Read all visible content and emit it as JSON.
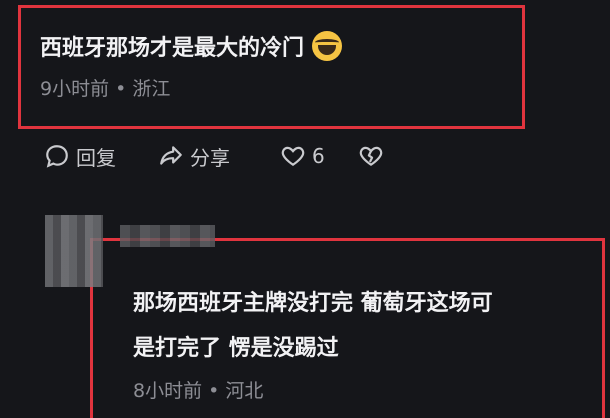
{
  "comment1": {
    "text": "西班牙那场才是最大的冷门",
    "emoji": "face-with-tears-of-joy-icon",
    "time": "9小时前",
    "location": "浙江"
  },
  "actions": {
    "reply_label": "回复",
    "share_label": "分享",
    "like_count": "6"
  },
  "comment2": {
    "line1": "那场西班牙主牌没打完 葡萄牙这场可",
    "line2": "是打完了 愣是没踢过",
    "time": "8小时前",
    "location": "河北"
  },
  "colors": {
    "background": "#15161a",
    "highlight": "#e0343e",
    "meta_text": "#8d8e95"
  }
}
